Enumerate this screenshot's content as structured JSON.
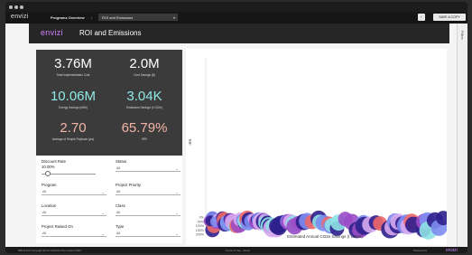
{
  "app": {
    "logo": "envizi",
    "breadcrumb": "Programs Overview",
    "separator": "/",
    "report_select": "ROI and Emissions",
    "info_label": "i",
    "save_label": "SAVE A COPY",
    "sidebar_label": "Filters"
  },
  "header": {
    "brand": "envizi",
    "title": "ROI and Emissions"
  },
  "kpis": [
    {
      "value": "3.76M",
      "label": "Total Implementation Cost",
      "color": "#ffffff"
    },
    {
      "value": "2.0M",
      "label": "Cost Savings ($)",
      "color": "#ffffff"
    },
    {
      "value": "10.06M",
      "label": "Energy Savings (kWh)",
      "color": "#8fe8e4"
    },
    {
      "value": "3.04K",
      "label": "Emissions Savings (t CO2e)",
      "color": "#8fe8e4"
    },
    {
      "value": "2.70",
      "label": "Average of Simple Payback (yrs)",
      "color": "#f2b5a8"
    },
    {
      "value": "65.79%",
      "label": "IRR",
      "color": "#f2b5a8"
    }
  ],
  "filters": {
    "discount_rate": {
      "label": "Discount Rate",
      "value": "10.00%",
      "fraction": 0.12
    },
    "status": {
      "label": "Status",
      "value": "All"
    },
    "program": {
      "label": "Program",
      "value": "All"
    },
    "project_priority": {
      "label": "Project Priority",
      "value": "All"
    },
    "location": {
      "label": "Location",
      "value": "All"
    },
    "class": {
      "label": "Class",
      "value": "All"
    },
    "project_raised_on": {
      "label": "Project Raised On",
      "value": "All"
    },
    "type": {
      "label": "Type",
      "value": "All"
    }
  },
  "chart_data": {
    "type": "scatter",
    "xlabel": "Estimated Annual CO2e Savings (t CO2e)",
    "ylabel": "IRR",
    "y_ticks": [
      "200%",
      "150%",
      "100%",
      "50%",
      "0%"
    ],
    "ylim": [
      0,
      200
    ],
    "grid": false,
    "colors": [
      "#2d1f8c",
      "#7d8cf0",
      "#9a4dc6",
      "#d8aaf0",
      "#ee6868",
      "#8de2e4"
    ],
    "points": [
      [
        8,
        8,
        7,
        0
      ],
      [
        8,
        21,
        8,
        1
      ],
      [
        4,
        47,
        6,
        2
      ],
      [
        8,
        150,
        8,
        0
      ],
      [
        10,
        102,
        8,
        4
      ],
      [
        13,
        65,
        7,
        2
      ],
      [
        6,
        44,
        6,
        0
      ],
      [
        15,
        34,
        7,
        3
      ],
      [
        12,
        56,
        6,
        1
      ],
      [
        18,
        73,
        5,
        2
      ],
      [
        20,
        8,
        7,
        0
      ],
      [
        22,
        25,
        8,
        4
      ],
      [
        23,
        85,
        8,
        0
      ],
      [
        26,
        62,
        8,
        5
      ],
      [
        27,
        68,
        9,
        1
      ],
      [
        29,
        27,
        7,
        0
      ],
      [
        31,
        42,
        8,
        2
      ],
      [
        33,
        58,
        9,
        3
      ],
      [
        35,
        110,
        7,
        5
      ],
      [
        37,
        103,
        8,
        4
      ],
      [
        40,
        77,
        8,
        4
      ],
      [
        40,
        90,
        9,
        2
      ],
      [
        42,
        28,
        8,
        3
      ],
      [
        44,
        38,
        7,
        1
      ],
      [
        45,
        74,
        6,
        0
      ],
      [
        47,
        60,
        7,
        2
      ],
      [
        48,
        48,
        9,
        5
      ],
      [
        49,
        52,
        7,
        2
      ],
      [
        50,
        20,
        9,
        4
      ],
      [
        51,
        72,
        8,
        1
      ],
      [
        52,
        30,
        8,
        0
      ],
      [
        55,
        48,
        8,
        1
      ],
      [
        57,
        22,
        6,
        3
      ],
      [
        60,
        46,
        7,
        2
      ],
      [
        61,
        60,
        8,
        2
      ],
      [
        62,
        31,
        7,
        0
      ],
      [
        64,
        28,
        8,
        1
      ],
      [
        66,
        58,
        9,
        3
      ],
      [
        68,
        40,
        9,
        3
      ],
      [
        70,
        52,
        9,
        0
      ],
      [
        71,
        34,
        7,
        3
      ],
      [
        72,
        71,
        8,
        5
      ],
      [
        74,
        58,
        7,
        0
      ],
      [
        74,
        78,
        8,
        0
      ],
      [
        76,
        96,
        9,
        5
      ],
      [
        77,
        104,
        8,
        0
      ],
      [
        80,
        130,
        10,
        3
      ],
      [
        82,
        102,
        9,
        5
      ],
      [
        85,
        142,
        9,
        3
      ],
      [
        86,
        104,
        9,
        0
      ],
      [
        88,
        117,
        9,
        0
      ],
      [
        90,
        80,
        9,
        0
      ],
      [
        94,
        61,
        8,
        0
      ],
      [
        98,
        51,
        8,
        1
      ],
      [
        100,
        60,
        9,
        2
      ],
      [
        102,
        52,
        8,
        3
      ],
      [
        106,
        78,
        9,
        5
      ],
      [
        107,
        108,
        9,
        2
      ],
      [
        112,
        72,
        8,
        2
      ],
      [
        118,
        58,
        9,
        0
      ],
      [
        122,
        46,
        9,
        1
      ],
      [
        128,
        57,
        8,
        4
      ],
      [
        136,
        20,
        9,
        0
      ],
      [
        137,
        57,
        8,
        5
      ],
      [
        142,
        70,
        9,
        1
      ],
      [
        148,
        78,
        8,
        4
      ],
      [
        150,
        110,
        8,
        1
      ],
      [
        152,
        95,
        8,
        5
      ],
      [
        158,
        135,
        8,
        0
      ],
      [
        160,
        64,
        9,
        5
      ],
      [
        168,
        22,
        8,
        2
      ],
      [
        176,
        58,
        9,
        2
      ],
      [
        182,
        152,
        9,
        0
      ],
      [
        186,
        148,
        9,
        2
      ],
      [
        190,
        61,
        8,
        1
      ],
      [
        191,
        103,
        10,
        0
      ],
      [
        198,
        88,
        9,
        3
      ],
      [
        205,
        64,
        8,
        0
      ],
      [
        210,
        75,
        8,
        4
      ],
      [
        222,
        142,
        10,
        0
      ],
      [
        225,
        120,
        9,
        3
      ],
      [
        228,
        52,
        9,
        1
      ],
      [
        231,
        98,
        9,
        0
      ],
      [
        232,
        55,
        9,
        3
      ],
      [
        237,
        75,
        8,
        0
      ],
      [
        240,
        100,
        9,
        1
      ],
      [
        242,
        64,
        9,
        1
      ],
      [
        244,
        110,
        9,
        3
      ],
      [
        248,
        56,
        9,
        4
      ],
      [
        250,
        90,
        9,
        0
      ],
      [
        262,
        152,
        8,
        0
      ],
      [
        263,
        56,
        9,
        2
      ],
      [
        267,
        40,
        9,
        1
      ],
      [
        268,
        156,
        10,
        5
      ],
      [
        276,
        40,
        9,
        0
      ],
      [
        281,
        125,
        9,
        1
      ],
      [
        286,
        12,
        8,
        0
      ]
    ]
  },
  "footer": {
    "left": "IBM Envizi Copyright Envizi Software Pty Limited 2023",
    "middle": "Terms of Use  ·  About",
    "right": "Powered by",
    "brand": "envizi"
  }
}
